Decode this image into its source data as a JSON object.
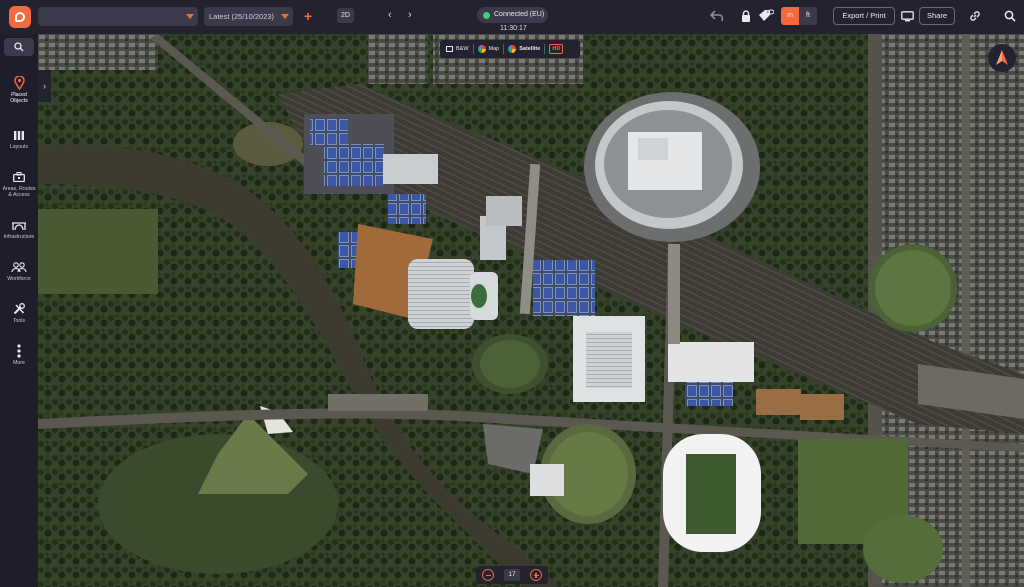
{
  "app": {
    "logo_icon": "location-pin-logo",
    "accent_color": "#f26a3d",
    "background_color": "#23222f"
  },
  "toolbar": {
    "project_select_value": "",
    "date_select_value": "Latest (25/10/2023)",
    "add_icon": "plus-icon",
    "view_mode": "2D",
    "prev_icon": "chevron-left-icon",
    "next_icon": "chevron-right-icon",
    "status": "Connected (EU)",
    "status_color": "#3ed07a",
    "time": "11:30:17",
    "undo_icon": "undo-icon",
    "lock_icon": "lock-icon",
    "visibility_icon": "eye-tag-icon",
    "units": [
      "m",
      "ft"
    ],
    "selected_unit": "m",
    "export_label": "Export / Print",
    "monitor_icon": "monitor-icon",
    "share_label": "Share",
    "link_icon": "link-icon",
    "search_icon": "search-icon"
  },
  "sidebar": {
    "search_icon": "search-icon",
    "items": [
      {
        "label_lines": [
          "Placed",
          "Objects"
        ],
        "icon": "location-pin-icon",
        "active": true
      },
      {
        "label_lines": [
          "Layouts"
        ],
        "icon": "columns-icon",
        "active": false
      },
      {
        "label_lines": [
          "Areas, Routes",
          "& Access"
        ],
        "icon": "toolbox-icon",
        "active": false
      },
      {
        "label_lines": [
          "Infrastructure"
        ],
        "icon": "bridge-icon",
        "active": false
      },
      {
        "label_lines": [
          "Workforce"
        ],
        "icon": "people-icon",
        "active": false
      },
      {
        "label_lines": [
          "Tools"
        ],
        "icon": "tools-icon",
        "active": false
      },
      {
        "label_lines": [
          "More"
        ],
        "icon": "more-vertical-icon",
        "active": false
      }
    ],
    "collapse_icon": "chevron-right-icon"
  },
  "map": {
    "type_options": [
      {
        "label": "B&W",
        "icon": "map-icon"
      },
      {
        "label": "Map",
        "icon": "google-icon"
      },
      {
        "label": "Satellite",
        "icon": "google-icon"
      }
    ],
    "hd_label": "HD",
    "compass_icon": "north-arrow-icon",
    "zoom_level": "17",
    "zoom_out_icon": "zoom-out-icon",
    "zoom_in_icon": "zoom-in-icon"
  }
}
